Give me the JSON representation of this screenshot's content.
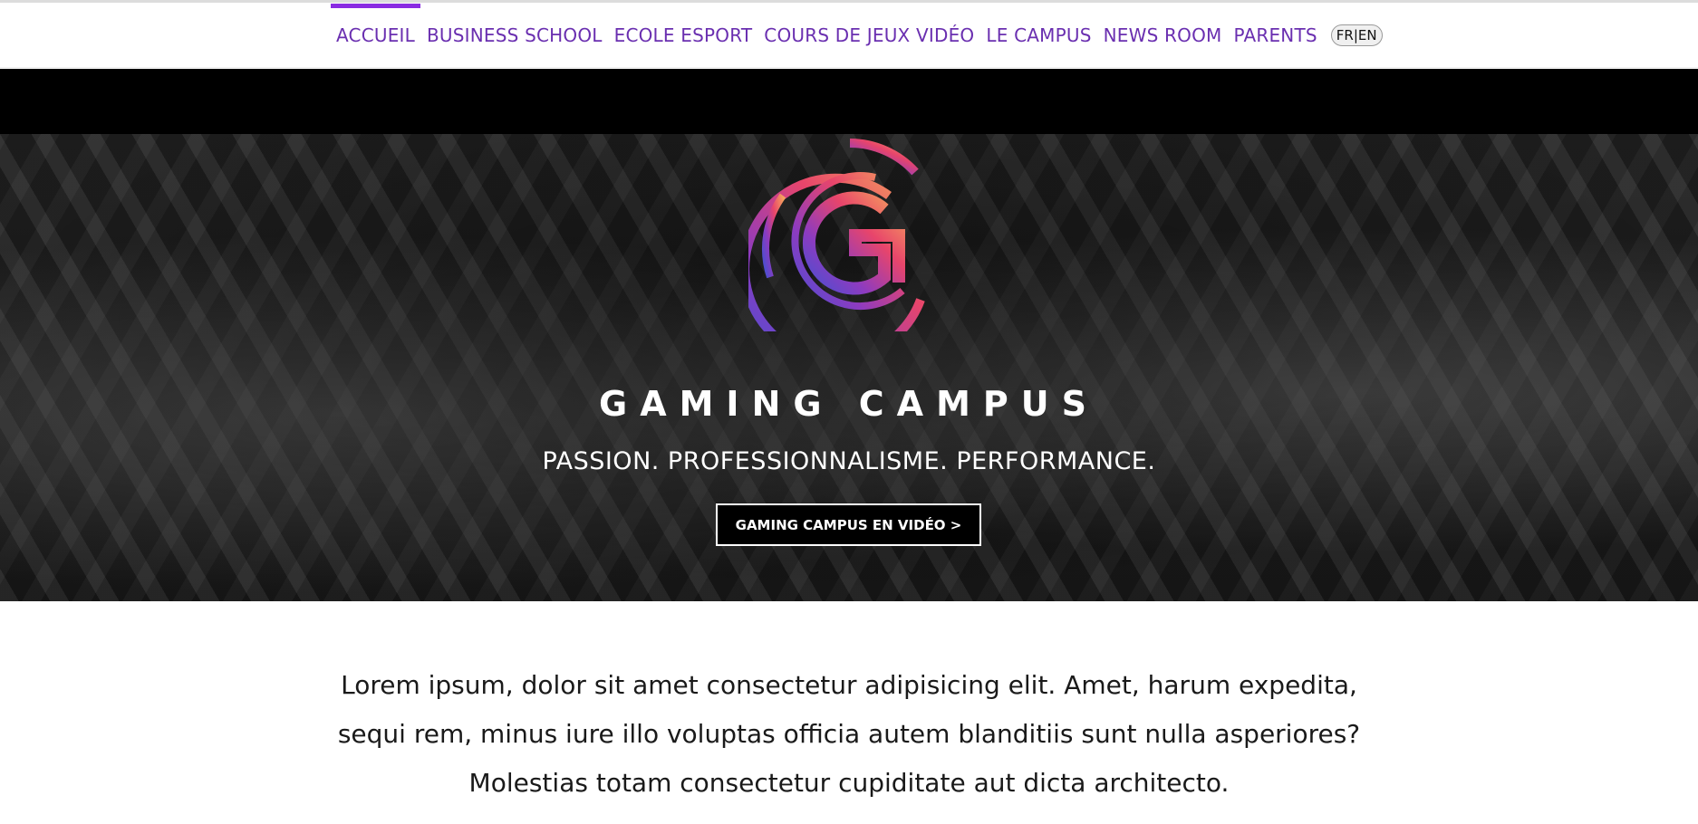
{
  "nav": {
    "items": [
      {
        "label": "ACCUEIL",
        "active": true
      },
      {
        "label": "BUSINESS SCHOOL",
        "active": false
      },
      {
        "label": "ECOLE ESPORT",
        "active": false
      },
      {
        "label": "COURS DE JEUX VIDÉO",
        "active": false
      },
      {
        "label": "LE CAMPUS",
        "active": false
      },
      {
        "label": "NEWS ROOM",
        "active": false
      },
      {
        "label": "PARENTS",
        "active": false
      }
    ],
    "language_toggle": "FR|EN"
  },
  "hero": {
    "brand_name": "GAMING CAMPUS",
    "tagline": "PASSION. PROFESSIONNALISME. PERFORMANCE.",
    "cta_label": "GAMING CAMPUS EN VIDÉO >"
  },
  "intro": {
    "text": "Lorem ipsum, dolor sit amet consectetur adipisicing elit. Amet, harum expedita, sequi rem, minus iure illo voluptas officia autem blanditiis sunt nulla asperiores? Molestias totam consectetur cupiditate aut dicta architecto."
  },
  "colors": {
    "nav_text": "#6a2fb0",
    "nav_active_bar": "#8a2be2",
    "logo_gradient": [
      "#f5a25d",
      "#e8456b",
      "#8e3bbf",
      "#4a4fd1"
    ]
  },
  "icons": {
    "logo": "gaming-campus-logo-icon"
  }
}
